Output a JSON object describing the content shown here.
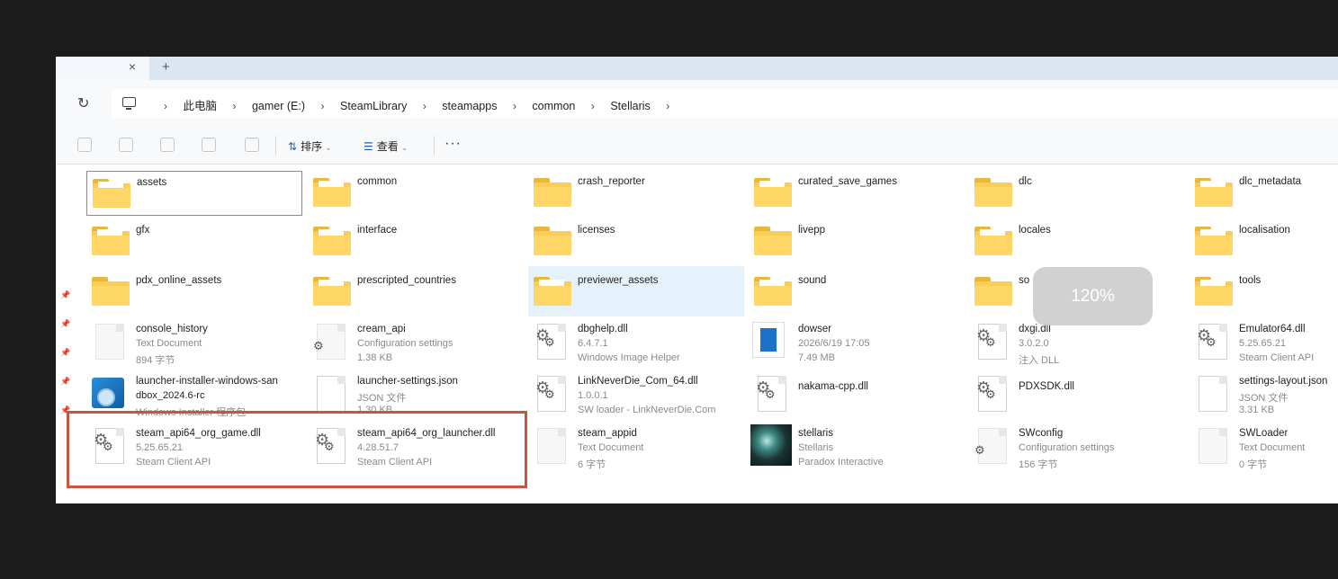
{
  "tabbar": {
    "close_glyph": "×",
    "new_tab_glyph": "+"
  },
  "address": {
    "refresh_glyph": "↻",
    "separator": "›",
    "crumbs": [
      "此电脑",
      "gamer (E:)",
      "SteamLibrary",
      "steamapps",
      "common",
      "Stellaris"
    ]
  },
  "toolbar": {
    "sort_icon": "⇅",
    "sort_label": "排序",
    "view_icon": "☰",
    "view_label": "查看",
    "caret": "⌄",
    "more_label": "···",
    "icons": [
      "cut-icon",
      "copy-icon",
      "rename-icon",
      "share-icon",
      "delete-icon"
    ]
  },
  "left_strip": {
    "pin_glyph": "📌"
  },
  "folders": [
    {
      "name": "assets"
    },
    {
      "name": "common"
    },
    {
      "name": "crash_reporter"
    },
    {
      "name": "curated_save_games"
    },
    {
      "name": "dlc"
    },
    {
      "name": "dlc_metadata"
    },
    {
      "name": "gfx"
    },
    {
      "name": "interface"
    },
    {
      "name": "licenses"
    },
    {
      "name": "livepp"
    },
    {
      "name": "locales"
    },
    {
      "name": "localisation"
    },
    {
      "name": "pdx_online_assets"
    },
    {
      "name": "prescripted_countries"
    },
    {
      "name": "previewer_assets"
    },
    {
      "name": "sound"
    },
    {
      "name": "so"
    },
    {
      "name": "tools"
    }
  ],
  "files": [
    {
      "name": "console_history",
      "line2": "Text Document",
      "line3": "894 字节"
    },
    {
      "name": "cream_api",
      "line2": "Configuration settings",
      "line3": "1.38 KB"
    },
    {
      "name": "dbghelp.dll",
      "line2": "6.4.7.1",
      "line3": "Windows Image Helper"
    },
    {
      "name": "dowser",
      "line2": "2026/6/19 17:05",
      "line3": "7.49 MB"
    },
    {
      "name": "dxgi.dll",
      "line2": "3.0.2.0",
      "line3": "注入 DLL"
    },
    {
      "name": "Emulator64.dll",
      "line2": "5.25.65.21",
      "line3": "Steam Client API"
    },
    {
      "name": "launcher-installer-windows-san",
      "line2": "dbox_2024.6-rc",
      "line3": "Windows Installer 程序包"
    },
    {
      "name": "launcher-settings.json",
      "line2": "JSON 文件",
      "line3": "1.30 KB"
    },
    {
      "name": "LinkNeverDie_Com_64.dll",
      "line2": "1.0.0.1",
      "line3": "SW loader - LinkNeverDie.Com"
    },
    {
      "name": "nakama-cpp.dll",
      "line2": "",
      "line3": ""
    },
    {
      "name": "PDXSDK.dll",
      "line2": "",
      "line3": ""
    },
    {
      "name": "settings-layout.json",
      "line2": "JSON 文件",
      "line3": "3.31 KB"
    },
    {
      "name": "steam_api64_org_game.dll",
      "line2": "5.25.65.21",
      "line3": "Steam Client API"
    },
    {
      "name": "steam_api64_org_launcher.dll",
      "line2": "4.28.51.7",
      "line3": "Steam Client API"
    },
    {
      "name": "steam_appid",
      "line2": "Text Document",
      "line3": "6 字节"
    },
    {
      "name": "stellaris",
      "line2": "Stellaris",
      "line3": "Paradox Interactive"
    },
    {
      "name": "SWconfig",
      "line2": "Configuration settings",
      "line3": "156 字节"
    },
    {
      "name": "SWLoader",
      "line2": "Text Document",
      "line3": "0 字节"
    }
  ],
  "zoom_toast": "120%",
  "colors": {
    "folder": "#ffd766",
    "highlight_box": "#c8553d",
    "selection_hover": "#e5f1fb"
  }
}
